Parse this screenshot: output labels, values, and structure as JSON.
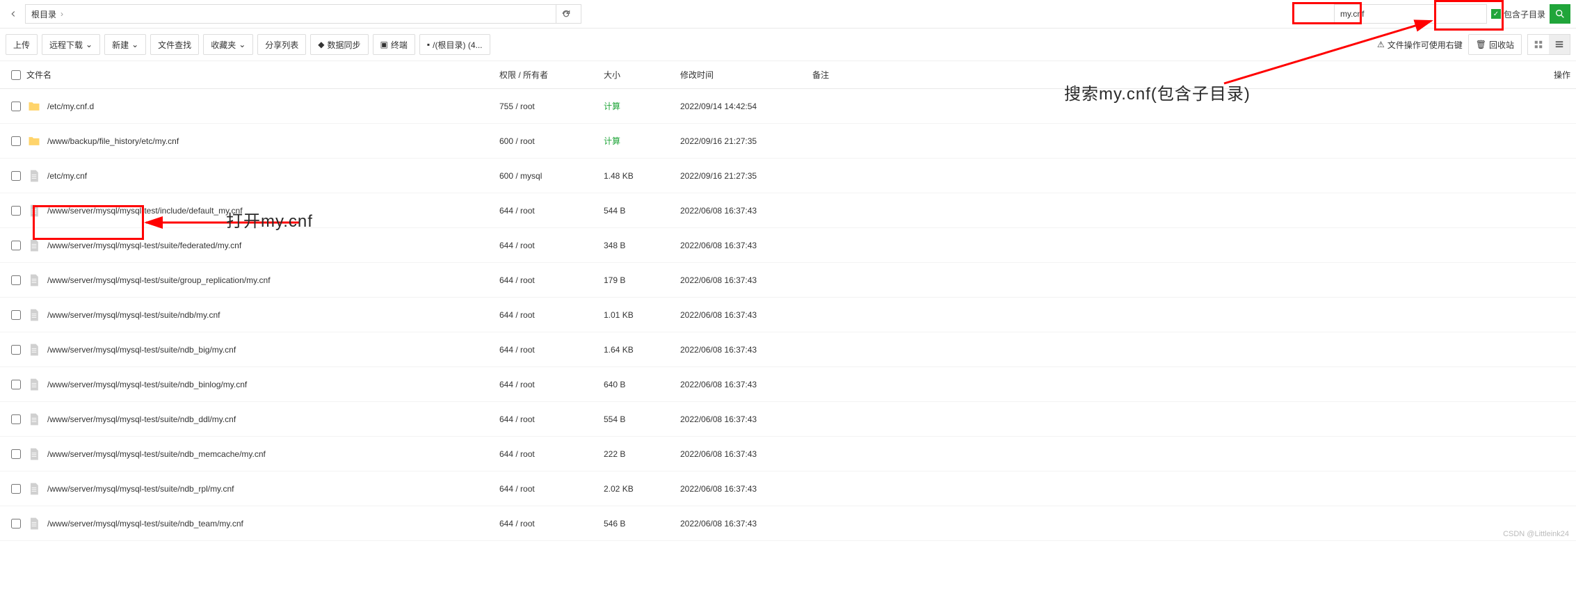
{
  "path": {
    "breadcrumb": "根目录",
    "chevron": "›"
  },
  "search": {
    "value": "my.cnf",
    "include_sub_label": "包含子目录"
  },
  "toolbar": {
    "upload": "上传",
    "remote_dl": "远程下载",
    "new": "新建",
    "find": "文件查找",
    "fav": "收藏夹",
    "share": "分享列表",
    "sync": "数据同步",
    "terminal": "终端",
    "rootpath": "/(根目录) (4...",
    "tip": "文件操作可使用右键",
    "trash": "回收站"
  },
  "headers": {
    "name": "文件名",
    "perm": "权限 / 所有者",
    "size": "大小",
    "time": "修改时间",
    "note": "备注",
    "op": "操作"
  },
  "rows": [
    {
      "icon": "folder",
      "name": "/etc/my.cnf.d",
      "perm": "755 / root",
      "size": "计算",
      "size_green": true,
      "time": "2022/09/14 14:42:54"
    },
    {
      "icon": "folder",
      "name": "/www/backup/file_history/etc/my.cnf",
      "perm": "600 / root",
      "size": "计算",
      "size_green": true,
      "time": "2022/09/16 21:27:35"
    },
    {
      "icon": "file",
      "name": "/etc/my.cnf",
      "perm": "600 / mysql",
      "size": "1.48 KB",
      "time": "2022/09/16 21:27:35"
    },
    {
      "icon": "file",
      "name": "/www/server/mysql/mysql-test/include/default_my.cnf",
      "perm": "644 / root",
      "size": "544 B",
      "time": "2022/06/08 16:37:43"
    },
    {
      "icon": "file",
      "name": "/www/server/mysql/mysql-test/suite/federated/my.cnf",
      "perm": "644 / root",
      "size": "348 B",
      "time": "2022/06/08 16:37:43"
    },
    {
      "icon": "file",
      "name": "/www/server/mysql/mysql-test/suite/group_replication/my.cnf",
      "perm": "644 / root",
      "size": "179 B",
      "time": "2022/06/08 16:37:43"
    },
    {
      "icon": "file",
      "name": "/www/server/mysql/mysql-test/suite/ndb/my.cnf",
      "perm": "644 / root",
      "size": "1.01 KB",
      "time": "2022/06/08 16:37:43"
    },
    {
      "icon": "file",
      "name": "/www/server/mysql/mysql-test/suite/ndb_big/my.cnf",
      "perm": "644 / root",
      "size": "1.64 KB",
      "time": "2022/06/08 16:37:43"
    },
    {
      "icon": "file",
      "name": "/www/server/mysql/mysql-test/suite/ndb_binlog/my.cnf",
      "perm": "644 / root",
      "size": "640 B",
      "time": "2022/06/08 16:37:43"
    },
    {
      "icon": "file",
      "name": "/www/server/mysql/mysql-test/suite/ndb_ddl/my.cnf",
      "perm": "644 / root",
      "size": "554 B",
      "time": "2022/06/08 16:37:43"
    },
    {
      "icon": "file",
      "name": "/www/server/mysql/mysql-test/suite/ndb_memcache/my.cnf",
      "perm": "644 / root",
      "size": "222 B",
      "time": "2022/06/08 16:37:43"
    },
    {
      "icon": "file",
      "name": "/www/server/mysql/mysql-test/suite/ndb_rpl/my.cnf",
      "perm": "644 / root",
      "size": "2.02 KB",
      "time": "2022/06/08 16:37:43"
    },
    {
      "icon": "file",
      "name": "/www/server/mysql/mysql-test/suite/ndb_team/my.cnf",
      "perm": "644 / root",
      "size": "546 B",
      "time": "2022/06/08 16:37:43"
    }
  ],
  "annotations": {
    "open_label": "打开my.cnf",
    "search_label": "搜索my.cnf(包含子目录)"
  },
  "watermark": "CSDN @Littleink24"
}
